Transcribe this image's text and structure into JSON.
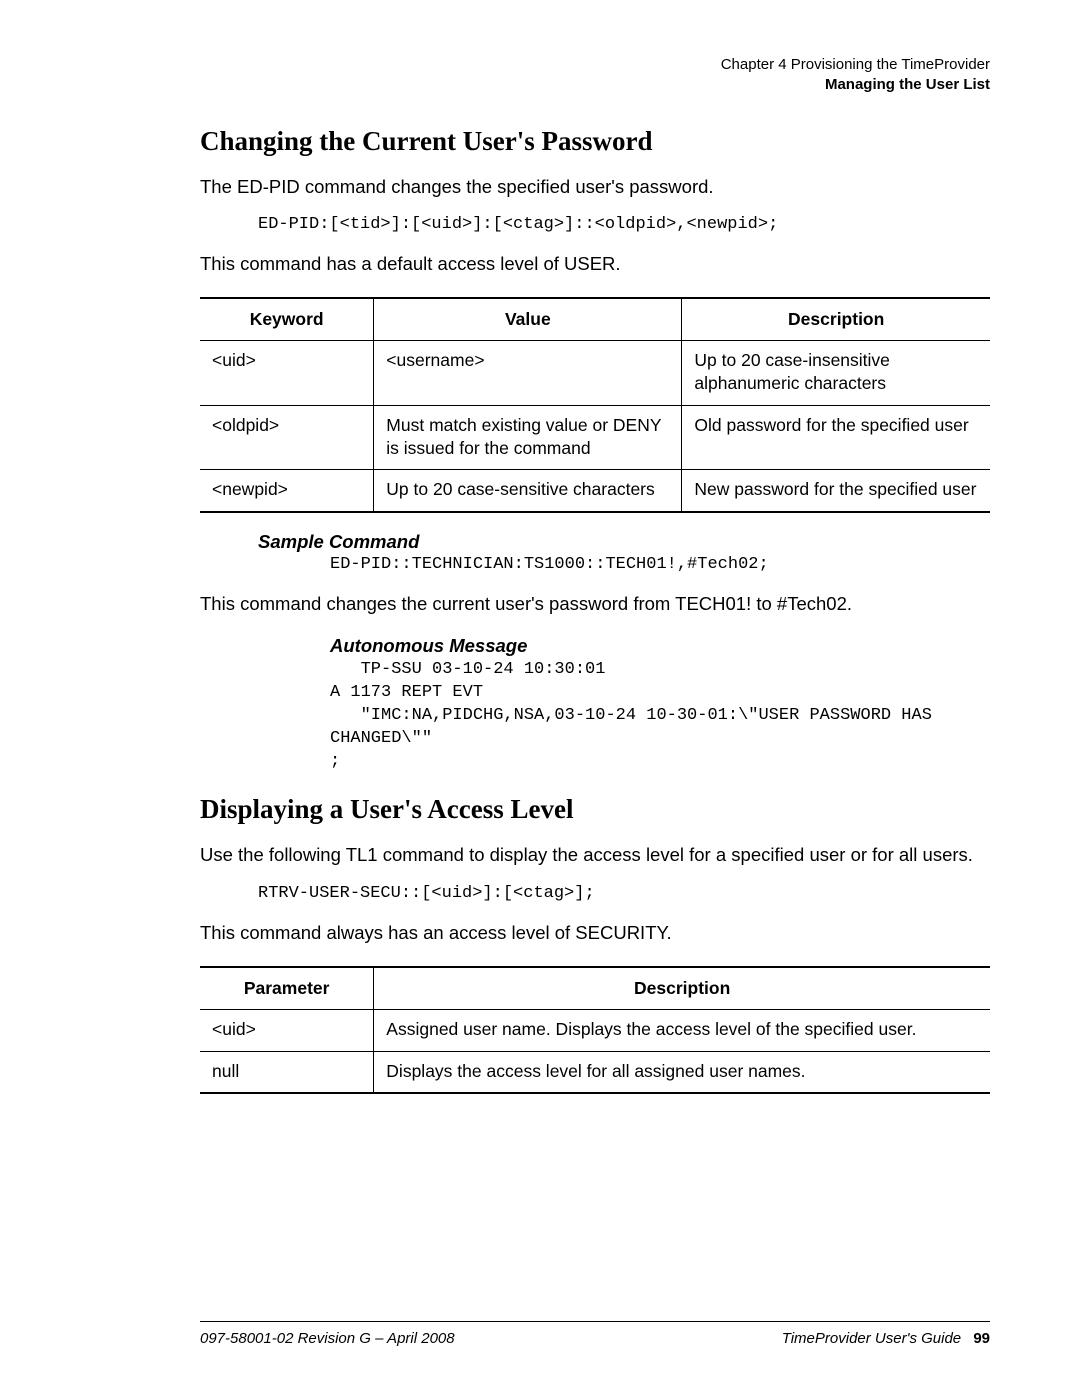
{
  "header": {
    "chapter": "Chapter 4 Provisioning the TimeProvider",
    "section": "Managing the User List"
  },
  "sec1": {
    "title": "Changing the Current User's Password",
    "intro": "The ED-PID command changes the specified user's password.",
    "syntax": "ED-PID:[<tid>]:[<uid>]:[<ctag>]::<oldpid>,<newpid>;",
    "access": "This command has a default access level of USER.",
    "table": {
      "headers": [
        "Keyword",
        "Value",
        "Description"
      ],
      "rows": [
        {
          "k": "<uid>",
          "v": "<username>",
          "d": "Up to 20 case-insensitive alphanumeric characters"
        },
        {
          "k": "<oldpid>",
          "v": "Must match existing value or DENY is issued for the command",
          "d": "Old password for the specified user"
        },
        {
          "k": "<newpid>",
          "v": "Up to 20 case-sensitive characters",
          "d": "New password for the specified user"
        }
      ]
    },
    "sample_label": "Sample Command",
    "sample_code": "ED-PID::TECHNICIAN:TS1000::TECH01!,#Tech02;",
    "sample_explain": "This command changes the current user's password from TECH01! to #Tech02.",
    "autonomous_label": "Autonomous Message",
    "autonomous_block": "   TP-SSU 03-10-24 10:30:01\nA 1173 REPT EVT\n   \"IMC:NA,PIDCHG,NSA,03-10-24 10-30-01:\\\"USER PASSWORD HAS\nCHANGED\\\"\"\n;"
  },
  "sec2": {
    "title": "Displaying a User's Access Level",
    "intro": "Use the following TL1 command to display the access level for a specified user or for all users.",
    "syntax": "RTRV-USER-SECU::[<uid>]:[<ctag>];",
    "access": "This command always has an access level of SECURITY.",
    "table": {
      "headers": [
        "Parameter",
        "Description"
      ],
      "rows": [
        {
          "p": "<uid>",
          "d": "Assigned user name. Displays the access level of the specified user."
        },
        {
          "p": "null",
          "d": "Displays the access level for all assigned user names."
        }
      ]
    }
  },
  "footer": {
    "left": "097-58001-02 Revision G – April 2008",
    "right_label": "TimeProvider User's Guide",
    "page": "99"
  }
}
